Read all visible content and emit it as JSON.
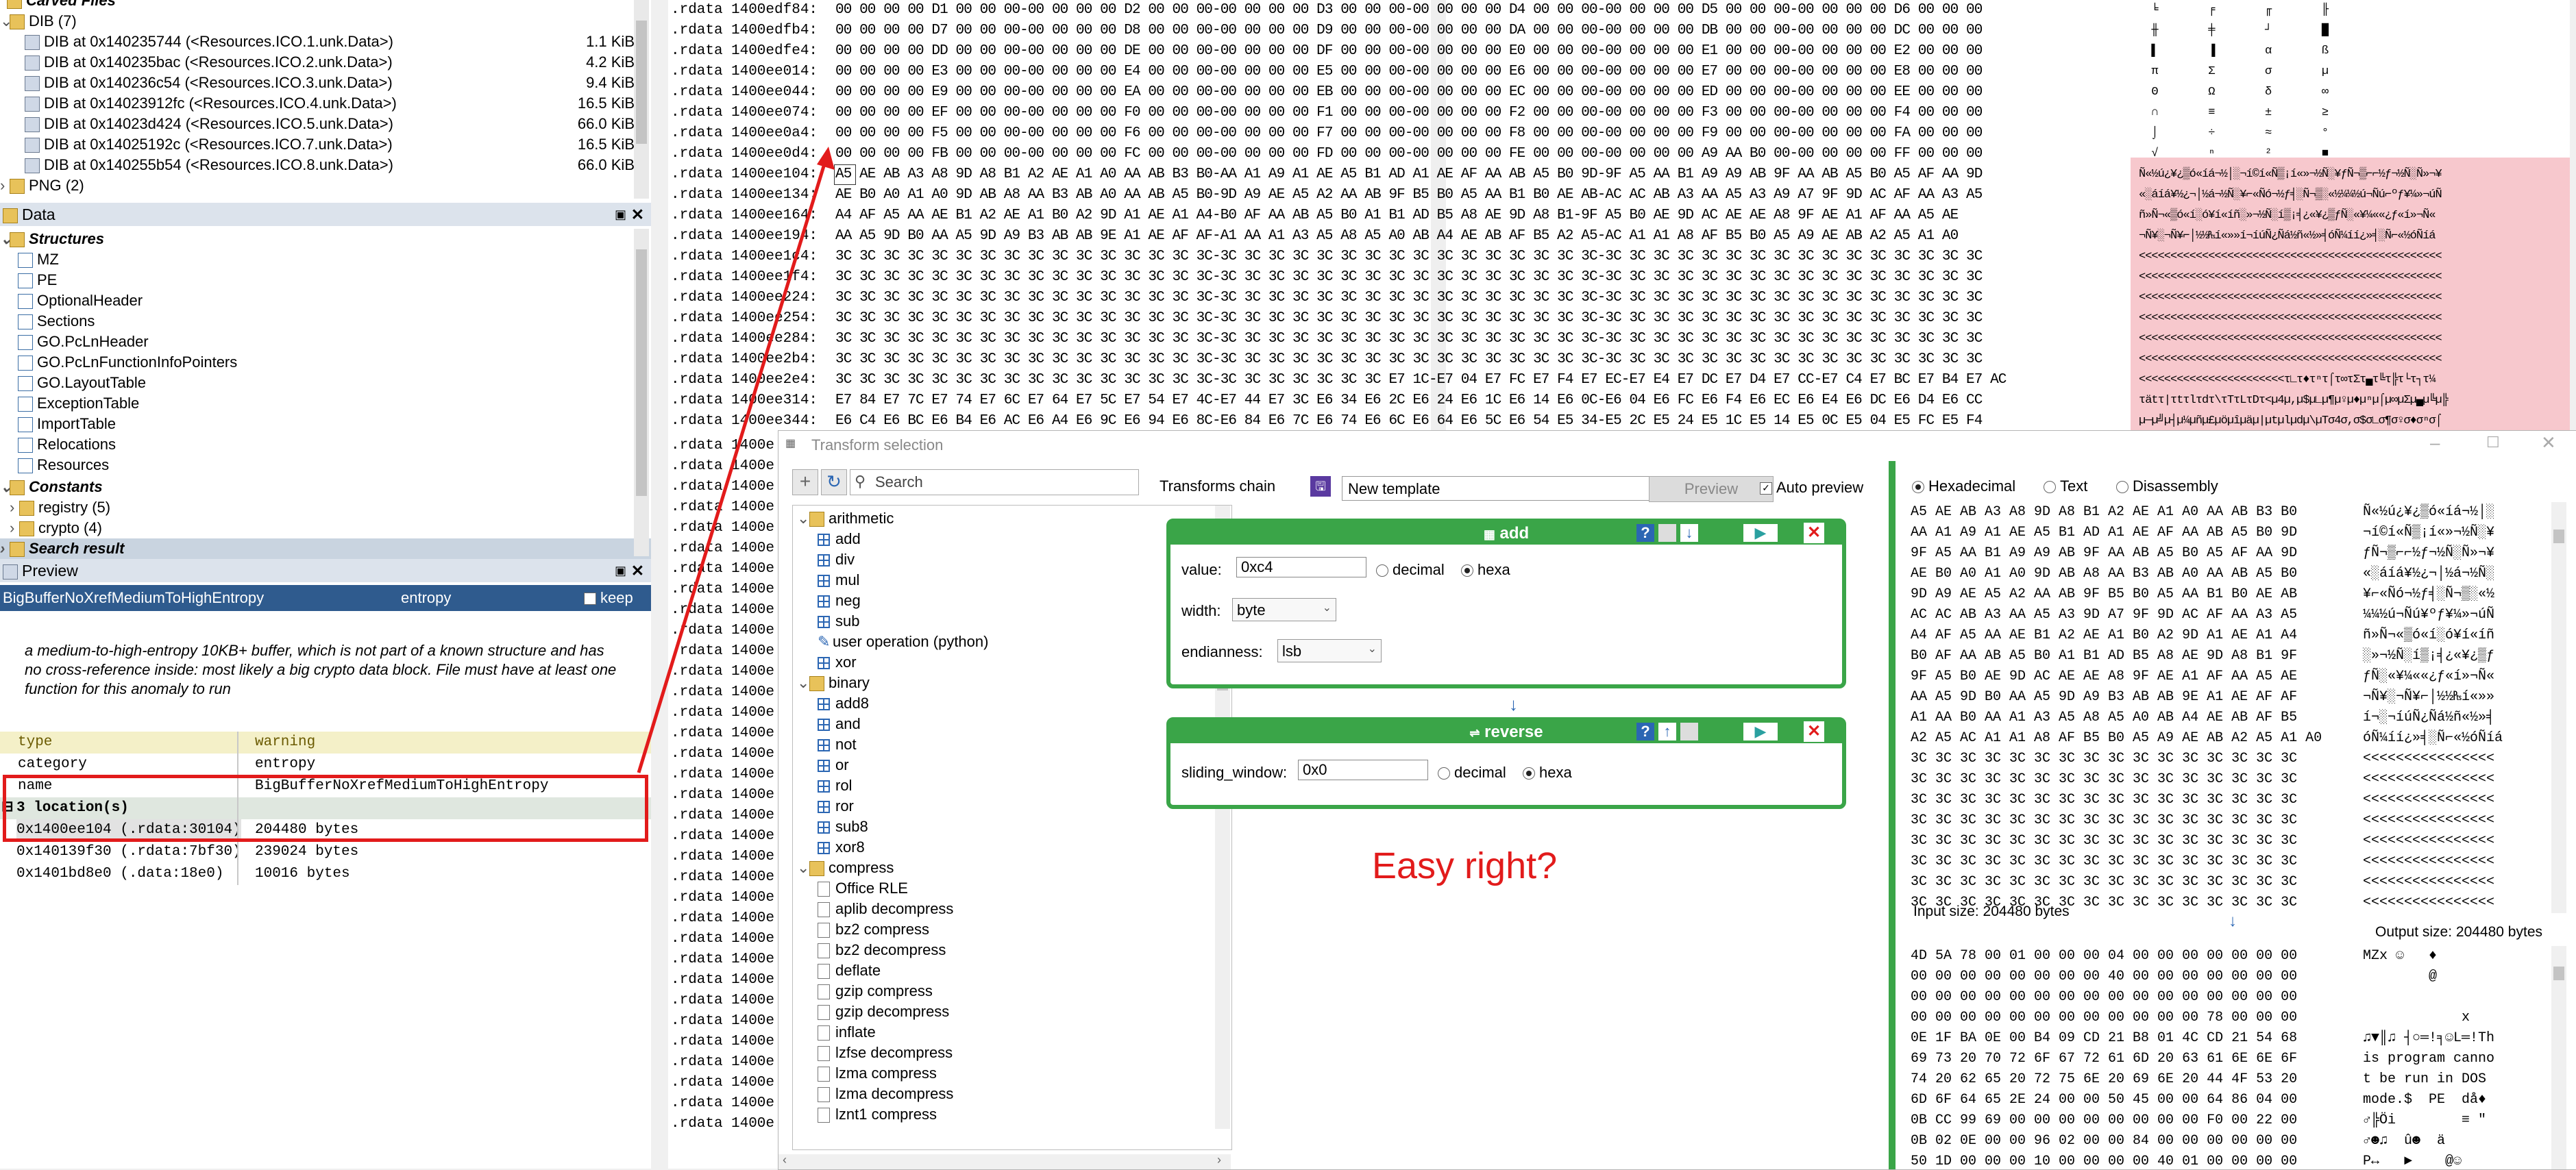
{
  "left": {
    "carved_title": "Carved Files",
    "dib_folder": "DIB (7)",
    "dib_items": [
      {
        "label": "DIB at 0x140235744 (<Resources.ICO.1.unk.Data>)",
        "size": "1.1 KiB"
      },
      {
        "label": "DIB at 0x140235bac (<Resources.ICO.2.unk.Data>)",
        "size": "4.2 KiB"
      },
      {
        "label": "DIB at 0x140236c54 (<Resources.ICO.3.unk.Data>)",
        "size": "9.4 KiB"
      },
      {
        "label": "DIB at 0x14023912fc (<Resources.ICO.4.unk.Data>)",
        "size": "16.5 KiB"
      },
      {
        "label": "DIB at 0x14023d424 (<Resources.ICO.5.unk.Data>)",
        "size": "66.0 KiB"
      },
      {
        "label": "DIB at 0x14025192c (<Resources.ICO.7.unk.Data>)",
        "size": "16.5 KiB"
      },
      {
        "label": "DIB at 0x140255b54 (<Resources.ICO.8.unk.Data>)",
        "size": "66.0 KiB"
      }
    ],
    "png_folder": "PNG (2)",
    "data_panel_title": "Data",
    "structures_label": "Structures",
    "structures": [
      "MZ",
      "PE",
      "OptionalHeader",
      "Sections",
      "GO.PcLnHeader",
      "GO.PcLnFunctionInfoPointers",
      "GO.LayoutTable",
      "ExceptionTable",
      "ImportTable",
      "Relocations",
      "Resources"
    ],
    "constants_label": "Constants",
    "constants": [
      "registry (5)",
      "crypto (4)"
    ],
    "search_result_label": "Search result",
    "preview_panel_title": "Preview",
    "preview_name": "BigBufferNoXrefMediumToHighEntropy",
    "preview_kind": "entropy",
    "keep_label": "keep",
    "description": "a medium-to-high-entropy 10KB+ buffer, which is not part of a known structure and has no cross-reference inside: most likely a big crypto data block. File must have at least one function for this anomaly to run",
    "table": [
      {
        "k": "type",
        "v": "warning"
      },
      {
        "k": "category",
        "v": "entropy"
      },
      {
        "k": "name",
        "v": "BigBufferNoXrefMediumToHighEntropy"
      }
    ],
    "locations_label": "3 location(s)",
    "locations": [
      {
        "addr": "0x1400ee104 (.rdata:30104)",
        "size": "204480 bytes"
      },
      {
        "addr": "0x140139f30 (.rdata:7bf30)",
        "size": "239024 bytes"
      },
      {
        "addr": "0x1401bd8e0 (.data:18e0)",
        "size": "10016 bytes"
      }
    ]
  },
  "hexdump": {
    "section": ".rdata",
    "rows": [
      {
        "addr": "1400edf84:",
        "hex": "00 00 00 00 D1 00 00 00-00 00 00 00 D2 00 00 00-00 00 00 00 D3 00 00 00-00 00 00 00 D4 00 00 00-00 00 00 00 D5 00 00 00-00 00 00 00 D6 00 00 00",
        "ascii": "  ╘        ╒        ╓        ╟"
      },
      {
        "addr": "1400edfb4:",
        "hex": "00 00 00 00 D7 00 00 00-00 00 00 00 D8 00 00 00-00 00 00 00 D9 00 00 00-00 00 00 00 DA 00 00 00-00 00 00 00 DB 00 00 00-00 00 00 00 DC 00 00 00",
        "ascii": "  ╫        ╪        ┘        █"
      },
      {
        "addr": "1400edfe4:",
        "hex": "00 00 00 00 DD 00 00 00-00 00 00 00 DE 00 00 00-00 00 00 00 DF 00 00 00-00 00 00 00 E0 00 00 00-00 00 00 00 E1 00 00 00-00 00 00 00 E2 00 00 00",
        "ascii": "  ▌        ▐        α        ß"
      },
      {
        "addr": "1400ee014:",
        "hex": "00 00 00 00 E3 00 00 00-00 00 00 00 E4 00 00 00-00 00 00 00 E5 00 00 00-00 00 00 00 E6 00 00 00-00 00 00 00 E7 00 00 00-00 00 00 00 E8 00 00 00",
        "ascii": "  π        Σ        σ        µ"
      },
      {
        "addr": "1400ee044:",
        "hex": "00 00 00 00 E9 00 00 00-00 00 00 00 EA 00 00 00-00 00 00 00 EB 00 00 00-00 00 00 00 EC 00 00 00-00 00 00 00 ED 00 00 00-00 00 00 00 EE 00 00 00",
        "ascii": "  Θ        Ω        δ        ∞"
      },
      {
        "addr": "1400ee074:",
        "hex": "00 00 00 00 EF 00 00 00-00 00 00 00 F0 00 00 00-00 00 00 00 F1 00 00 00-00 00 00 00 F2 00 00 00-00 00 00 00 F3 00 00 00-00 00 00 00 F4 00 00 00",
        "ascii": "  ∩        ≡        ±        ≥"
      },
      {
        "addr": "1400ee0a4:",
        "hex": "00 00 00 00 F5 00 00 00-00 00 00 00 F6 00 00 00-00 00 00 00 F7 00 00 00-00 00 00 00 F8 00 00 00-00 00 00 00 F9 00 00 00-00 00 00 00 FA 00 00 00",
        "ascii": "  ⌡        ÷        ≈        °"
      },
      {
        "addr": "1400ee0d4:",
        "hex": "00 00 00 00 FB 00 00 00-00 00 00 00 FC 00 00 00-00 00 00 00 FD 00 00 00-00 00 00 00 FE 00 00 00-00 00 00 00 A9 AA B0 00-00 00 00 00 FF 00 00 00",
        "ascii": "  √        ⁿ        ²        ■"
      },
      {
        "addr": "1400ee104:",
        "hex": "A5 AE AB A3 A8 9D A8 B1 A2 AE A1 A0 AA AB B3 B0-AA A1 A9 A1 AE A5 B1 AD A1 AE AF AA AB A5 B0 9D-9F A5 AA B1 A9 A9 AB 9F AA AB A5 B0 A5 AF AA 9D",
        "ascii": "Ñ«½ú¿¥¿▒ó«íá¬½│░¬í©í«Ñ▒¡í«»¬½Ñ░¥ƒÑ¬▒⌐⌐½ƒ¬½Ñ░Ñ»¬¥"
      },
      {
        "addr": "1400ee134:",
        "hex": "AE B0 A0 A1 A0 9D AB A8 AA B3 AB A0 AA AB A5 B0-9D A9 AE A5 A2 AA AB 9F B5 B0 A5 AA B1 B0 AE AB-AC AC AB A3 AA A5 A3 A9 A7 9F 9D AC AF AA A3 A5",
        "ascii": "«░áíá¥½¿¬│½á¬½Ñ░¥⌐«Ñó¬½ƒ╡░Ñ¬▒░«½¼¼½ú¬Ñú⌐ºƒ¥¼»¬úÑ"
      },
      {
        "addr": "1400ee164:",
        "hex": "A4 AF A5 AA AE B1 A2 AE A1 B0 A2 9D A1 AE A1 A4-B0 AF AA AB A5 B0 A1 B1 AD B5 A8 AE 9D A8 B1-9F A5 B0 AE 9D AC AE AE A8 9F AE A1 AF AA A5 AE",
        "ascii": "ñ»Ñ¬«▒ó«í░ó¥í«íñ░»¬½Ñ░í▒¡╡¿«¥¿▒ƒÑ░«¥¼««¿ƒ«í»¬Ñ«"
      },
      {
        "addr": "1400ee194:",
        "hex": "AA A5 9D B0 AA A5 9D A9 B3 AB AB 9E A1 AE AF AF-A1 AA A1 A3 A5 A8 A5 A0 AB A4 AE AB AF B5 A2 A5-AC A1 A1 A8 AF B5 B0 A5 A9 AE AB A2 A5 A1 A0",
        "ascii": "¬Ñ¥░¬Ñ¥⌐│½½₧í«»»í¬íúÑ¿Ñá½ñ«½»╡óÑ¼íí¿»╡░Ñ⌐«½óÑíá"
      },
      {
        "addr": "1400ee1c4:",
        "hex": "3C 3C 3C 3C 3C 3C 3C 3C 3C 3C 3C 3C 3C 3C 3C 3C-3C 3C 3C 3C 3C 3C 3C 3C 3C 3C 3C 3C 3C 3C 3C 3C-3C 3C 3C 3C 3C 3C 3C 3C 3C 3C 3C 3C 3C 3C 3C 3C",
        "ascii": "<<<<<<<<<<<<<<<<<<<<<<<<<<<<<<<<<<<<<<<<<<<<<<<<"
      },
      {
        "addr": "1400ee1f4:",
        "hex": "3C 3C 3C 3C 3C 3C 3C 3C 3C 3C 3C 3C 3C 3C 3C 3C-3C 3C 3C 3C 3C 3C 3C 3C 3C 3C 3C 3C 3C 3C 3C 3C-3C 3C 3C 3C 3C 3C 3C 3C 3C 3C 3C 3C 3C 3C 3C 3C",
        "ascii": "<<<<<<<<<<<<<<<<<<<<<<<<<<<<<<<<<<<<<<<<<<<<<<<<"
      },
      {
        "addr": "1400ee224:",
        "hex": "3C 3C 3C 3C 3C 3C 3C 3C 3C 3C 3C 3C 3C 3C 3C 3C-3C 3C 3C 3C 3C 3C 3C 3C 3C 3C 3C 3C 3C 3C 3C 3C-3C 3C 3C 3C 3C 3C 3C 3C 3C 3C 3C 3C 3C 3C 3C 3C",
        "ascii": "<<<<<<<<<<<<<<<<<<<<<<<<<<<<<<<<<<<<<<<<<<<<<<<<"
      },
      {
        "addr": "1400ee254:",
        "hex": "3C 3C 3C 3C 3C 3C 3C 3C 3C 3C 3C 3C 3C 3C 3C 3C-3C 3C 3C 3C 3C 3C 3C 3C 3C 3C 3C 3C 3C 3C 3C 3C-3C 3C 3C 3C 3C 3C 3C 3C 3C 3C 3C 3C 3C 3C 3C 3C",
        "ascii": "<<<<<<<<<<<<<<<<<<<<<<<<<<<<<<<<<<<<<<<<<<<<<<<<"
      },
      {
        "addr": "1400ee284:",
        "hex": "3C 3C 3C 3C 3C 3C 3C 3C 3C 3C 3C 3C 3C 3C 3C 3C-3C 3C 3C 3C 3C 3C 3C 3C 3C 3C 3C 3C 3C 3C 3C 3C-3C 3C 3C 3C 3C 3C 3C 3C 3C 3C 3C 3C 3C 3C 3C 3C",
        "ascii": "<<<<<<<<<<<<<<<<<<<<<<<<<<<<<<<<<<<<<<<<<<<<<<<<"
      },
      {
        "addr": "1400ee2b4:",
        "hex": "3C 3C 3C 3C 3C 3C 3C 3C 3C 3C 3C 3C 3C 3C 3C 3C-3C 3C 3C 3C 3C 3C 3C 3C 3C 3C 3C 3C 3C 3C 3C 3C-3C 3C 3C 3C 3C 3C 3C 3C 3C 3C 3C 3C 3C 3C 3C 3C",
        "ascii": "<<<<<<<<<<<<<<<<<<<<<<<<<<<<<<<<<<<<<<<<<<<<<<<<"
      },
      {
        "addr": "1400ee2e4:",
        "hex": "3C 3C 3C 3C 3C 3C 3C 3C 3C 3C 3C 3C 3C 3C 3C 3C-3C 3C 3C 3C 3C 3C 3C E7 1C-E7 04 E7 FC E7 F4 E7 EC-E7 E4 E7 DC E7 D4 E7 CC-E7 C4 E7 BC E7 B4 E7 AC",
        "ascii": "<<<<<<<<<<<<<<<<<<<<<<<τ∟τ♦τⁿτ⌠τ∞τΣτ▄τ╚τ╠τ└τ┐τ¼"
      },
      {
        "addr": "1400ee314:",
        "hex": "E7 84 E7 7C E7 74 E7 6C E7 64 E7 5C E7 54 E7 4C-E7 44 E7 3C E6 34 E6 2C E6 24 E6 1C E6 14 E6 0C-E6 04 E6 FC E6 F4 E6 EC E6 E4 E6 DC E6 D4 E6 CC",
        "ascii": "τätτ|τtτlτdτ\\τTτLτDτ<µ4µ,µ$µ∟µ¶µ♀µ♦µⁿµ⌠µ∞µΣµ▄µ╚µ╠"
      },
      {
        "addr": "1400ee344:",
        "hex": "E6 C4 E6 BC E6 B4 E6 AC E6 A4 E6 9C E6 94 E6 8C-E6 84 E6 7C E6 74 E6 6C E6 64 E6 5C E6 54 E5 34-E5 2C E5 24 E5 1C E5 14 E5 0C E5 04 E5 FC E5 F4",
        "ascii": "µ─µ╝µ┤µ¼µñµ£µöµîµäµ|µtµlµdµ\\µTσ4σ,σ$σ∟σ¶σ♀σ♦σⁿσ⌠"
      },
      {
        "addr": "1400ee374:",
        "hex": "E5 EC E5 E4 E5 DC E5 D4 E5 CC E5 C4 E5 BC E5 B4-E5 AC E5 A4 E5 9C E5 94 E5 8C E5 84 E5 7C E5 74-E5 6C E5 64 E5 5C E5 54 E5 4C E5 44 E5 34 E4 2C",
        "ascii": "σ∞σΣσ▄σ╚σ╠σ─σ╝σ┤σ¼σñσ£σöσîσäσ|σtσlσdσ\\σTσLσDσ4Σ,"
      },
      {
        "addr": "1400e",
        "hex": "",
        "ascii": ""
      }
    ],
    "lower_rows": [
      "1400e",
      "1400e",
      "1400e",
      "1400e",
      "1400e",
      "1400e",
      "1400e",
      "1400e",
      "1400e",
      "1400e",
      "1400e",
      "1400e",
      "1400e",
      "1400e",
      "1400e",
      "1400e",
      "1400e",
      "1400e",
      "1400e",
      "1400e",
      "1400e",
      "1400e",
      "1400e",
      "1400e",
      "1400e",
      "1400e",
      "1400e",
      "1400e",
      "1400e",
      "1400e",
      "1400e",
      "1400e",
      "1400e",
      "1400e"
    ]
  },
  "transform": {
    "title": "Transform selection",
    "search_placeholder": "Search",
    "chain_label": "Transforms chain",
    "template_value": "New template",
    "preview_button": "Preview",
    "auto_preview": "Auto preview",
    "tree": [
      {
        "t": "arithmetic",
        "kind": "folder"
      },
      {
        "t": "add",
        "kind": "op"
      },
      {
        "t": "div",
        "kind": "op"
      },
      {
        "t": "mul",
        "kind": "op"
      },
      {
        "t": "neg",
        "kind": "op"
      },
      {
        "t": "sub",
        "kind": "op"
      },
      {
        "t": "user operation (python)",
        "kind": "user"
      },
      {
        "t": "xor",
        "kind": "op"
      },
      {
        "t": "binary",
        "kind": "folder"
      },
      {
        "t": "add8",
        "kind": "op"
      },
      {
        "t": "and",
        "kind": "op"
      },
      {
        "t": "not",
        "kind": "op"
      },
      {
        "t": "or",
        "kind": "op"
      },
      {
        "t": "rol",
        "kind": "op"
      },
      {
        "t": "ror",
        "kind": "op"
      },
      {
        "t": "sub8",
        "kind": "op"
      },
      {
        "t": "xor8",
        "kind": "op"
      },
      {
        "t": "compress",
        "kind": "folder"
      },
      {
        "t": "Office RLE",
        "kind": "page"
      },
      {
        "t": "aplib decompress",
        "kind": "page"
      },
      {
        "t": "bz2 compress",
        "kind": "page"
      },
      {
        "t": "bz2 decompress",
        "kind": "page"
      },
      {
        "t": "deflate",
        "kind": "page"
      },
      {
        "t": "gzip compress",
        "kind": "page"
      },
      {
        "t": "gzip decompress",
        "kind": "page"
      },
      {
        "t": "inflate",
        "kind": "page"
      },
      {
        "t": "lzfse decompress",
        "kind": "page"
      },
      {
        "t": "lzma compress",
        "kind": "page"
      },
      {
        "t": "lzma decompress",
        "kind": "page"
      },
      {
        "t": "lznt1 compress",
        "kind": "page"
      }
    ],
    "add_card": {
      "title": "add",
      "value_label": "value:",
      "value": "0xc4",
      "decimal": "decimal",
      "hexa": "hexa",
      "width_label": "width:",
      "width_value": "byte",
      "endianness_label": "endianness:",
      "endianness_value": "lsb"
    },
    "reverse_card": {
      "title": "reverse",
      "sliding_label": "sliding_window:",
      "sliding_value": "0x0",
      "decimal": "decimal",
      "hexa": "hexa"
    },
    "easy_text": "Easy right?",
    "view_modes": [
      "Hexadecimal",
      "Text",
      "Disassembly"
    ],
    "input_hex": [
      "A5 AE AB A3 A8 9D A8 B1 A2 AE A1 A0 AA AB B3 B0",
      "AA A1 A9 A1 AE A5 B1 AD A1 AE AF AA AB A5 B0 9D",
      "9F A5 AA B1 A9 A9 AB 9F AA AB A5 B0 A5 AF AA 9D",
      "AE B0 A0 A1 A0 9D AB A8 AA B3 AB A0 AA AB A5 B0",
      "9D A9 AE A5 A2 AA AB 9F B5 B0 A5 AA B1 B0 AE AB",
      "AC AC AB A3 AA A5 A3 9D A7 9F 9D AC AF AA A3 A5",
      "A4 AF A5 AA AE B1 A2 AE A1 B0 A2 9D A1 AE A1 A4",
      "B0 AF AA AB A5 B0 A1 B1 AD B5 A8 AE 9D A8 B1 9F",
      "9F A5 B0 AE 9D AC AE AE A8 9F AE A1 AF AA A5 AE",
      "AA A5 9D B0 AA A5 9D A9 B3 AB AB 9E A1 AE AF AF",
      "A1 AA B0 AA A1 A3 A5 A8 A5 A0 AB A4 AE AB AF B5",
      "A2 A5 AC A1 A1 A8 AF B5 B0 A5 A9 AE AB A2 A5 A1 A0",
      "3C 3C 3C 3C 3C 3C 3C 3C 3C 3C 3C 3C 3C 3C 3C 3C",
      "3C 3C 3C 3C 3C 3C 3C 3C 3C 3C 3C 3C 3C 3C 3C 3C",
      "3C 3C 3C 3C 3C 3C 3C 3C 3C 3C 3C 3C 3C 3C 3C 3C",
      "3C 3C 3C 3C 3C 3C 3C 3C 3C 3C 3C 3C 3C 3C 3C 3C",
      "3C 3C 3C 3C 3C 3C 3C 3C 3C 3C 3C 3C 3C 3C 3C 3C",
      "3C 3C 3C 3C 3C 3C 3C 3C 3C 3C 3C 3C 3C 3C 3C 3C",
      "3C 3C 3C 3C 3C 3C 3C 3C 3C 3C 3C 3C 3C 3C 3C 3C",
      "3C 3C 3C 3C 3C 3C 3C 3C 3C 3C 3C 3C 3C 3C 3C 3C"
    ],
    "input_ascii": [
      "Ñ«½ú¿¥¿▒ó«íá¬½│░",
      "¬í©í«Ñ▒¡í«»¬½Ñ░¥",
      "ƒÑ¬▒⌐⌐½ƒ¬½Ñ░Ñ»¬¥",
      "«░áíá¥½¿¬│½á¬½Ñ░",
      "¥⌐«Ñó¬½ƒ╡░Ñ¬▒░«½",
      "¼¼½ú¬Ñú¥ºƒ¥¼»¬úÑ",
      "ñ»Ñ¬«▒ó«í░ó¥í«íñ",
      "░»¬½Ñ░í▒¡╡¿«¥¿▒ƒ",
      "ƒÑ░«¥¼««¿ƒ«í»¬Ñ«",
      "¬Ñ¥░¬Ñ¥⌐│½½₧í«»»",
      "í¬░¬íúÑ¿Ñá½ñ«½»╡",
      "óÑ¼íí¿»╡░Ñ⌐«½óÑíá",
      "<<<<<<<<<<<<<<<<",
      "<<<<<<<<<<<<<<<<",
      "<<<<<<<<<<<<<<<<",
      "<<<<<<<<<<<<<<<<",
      "<<<<<<<<<<<<<<<<",
      "<<<<<<<<<<<<<<<<",
      "<<<<<<<<<<<<<<<<",
      "<<<<<<<<<<<<<<<<"
    ],
    "input_size": "Input size: 204480 bytes",
    "output_size": "Output size: 204480 bytes",
    "output_hex": [
      "4D 5A 78 00 01 00 00 00 04 00 00 00 00 00 00 00",
      "00 00 00 00 00 00 00 00 40 00 00 00 00 00 00 00",
      "00 00 00 00 00 00 00 00 00 00 00 00 00 00 00 00",
      "00 00 00 00 00 00 00 00 00 00 00 00 78 00 00 00",
      "0E 1F BA 0E 00 B4 09 CD 21 B8 01 4C CD 21 54 68",
      "69 73 20 70 72 6F 67 72 61 6D 20 63 61 6E 6E 6F",
      "74 20 62 65 20 72 75 6E 20 69 6E 20 44 4F 53 20",
      "6D 6F 64 65 2E 24 00 00 50 45 00 00 64 86 04 00",
      "0B CC 99 69 00 00 00 00 00 00 00 00 F0 00 22 00",
      "0B 02 0E 00 00 96 02 00 00 84 00 00 00 00 00 00",
      "50 1D 00 00 00 10 00 00 00 00 40 01 00 00 00 00"
    ],
    "output_ascii": [
      "MZx ☺   ♦",
      "        @",
      "",
      "            x",
      "♫▼║♫ ┤○═!╕☺L═!Th",
      "is program canno",
      "t be run in DOS ",
      "mode.$  PE  då♦",
      "♂╠Öi        ≡ \"",
      "♂☻♫  û☻  ä",
      "P↔   ►    @☺"
    ]
  }
}
